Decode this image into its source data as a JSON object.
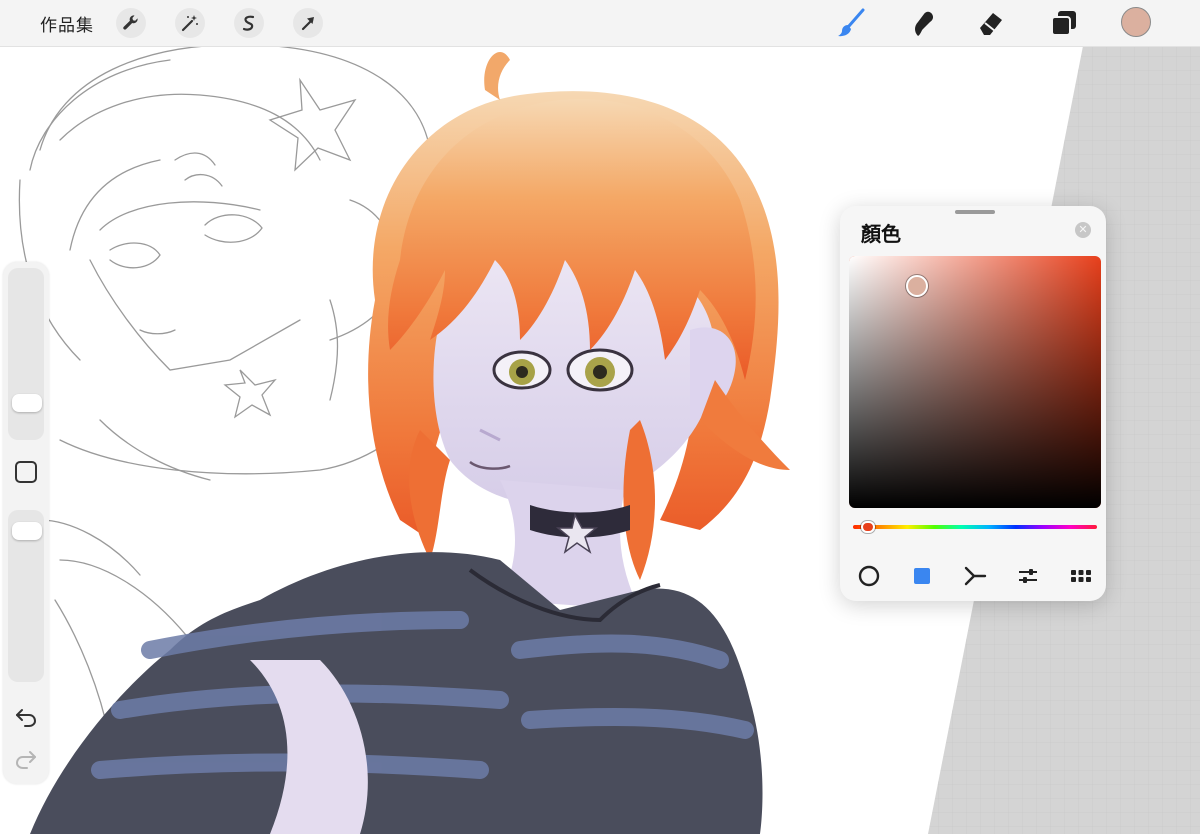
{
  "app": {
    "gallery_label": "作品集"
  },
  "toolbar": {
    "left_tools": [
      {
        "name": "actions",
        "icon": "wrench-icon"
      },
      {
        "name": "adjustments",
        "icon": "magic-wand-icon"
      },
      {
        "name": "selection",
        "icon": "selection-s-icon"
      },
      {
        "name": "transform",
        "icon": "arrow-cursor-icon"
      }
    ],
    "right_tools": [
      {
        "name": "brush",
        "icon": "brush-icon",
        "active": true
      },
      {
        "name": "smudge",
        "icon": "smudge-icon",
        "active": false
      },
      {
        "name": "eraser",
        "icon": "eraser-icon",
        "active": false
      },
      {
        "name": "layers",
        "icon": "layers-icon",
        "active": false
      }
    ],
    "current_color": "#dbb09f"
  },
  "sidebar": {
    "brush_size_level": 0.18,
    "opacity_level": 0.92,
    "icons": [
      "modify-square-icon",
      "undo-icon",
      "redo-icon"
    ]
  },
  "color_panel": {
    "title": "顏色",
    "hue_color": "#e8401c",
    "selected_color": "#dbb09f",
    "hue_position": 0.06,
    "saturation": 0.27,
    "brightness": 0.88,
    "modes": [
      "disc",
      "classic",
      "harmony",
      "value",
      "palettes"
    ],
    "active_mode": "classic",
    "accent": "#3a86f0"
  },
  "colors": {
    "toolbar_bg": "#f4f4f4",
    "active_tool": "#3a86f0",
    "workspace_gray": "#d3d3d3"
  }
}
